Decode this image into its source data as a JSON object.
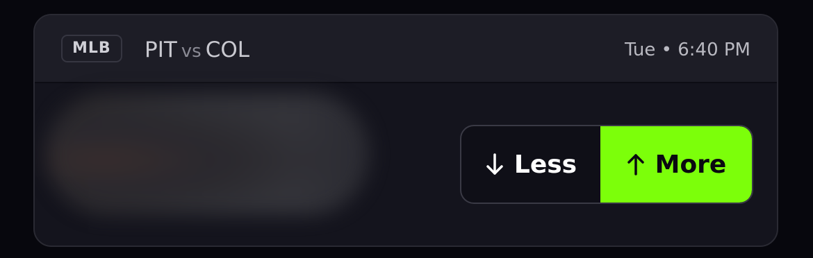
{
  "game": {
    "league": "MLB",
    "team_home": "PIT",
    "vs_label": "vs",
    "team_away": "COL",
    "time": "Tue • 6:40 PM"
  },
  "pick": {
    "less_label": "Less",
    "less_icon": "arrow-down-icon",
    "more_label": "More",
    "more_icon": "arrow-up-icon",
    "selected": "More",
    "accent_color": "#7cff0a"
  }
}
